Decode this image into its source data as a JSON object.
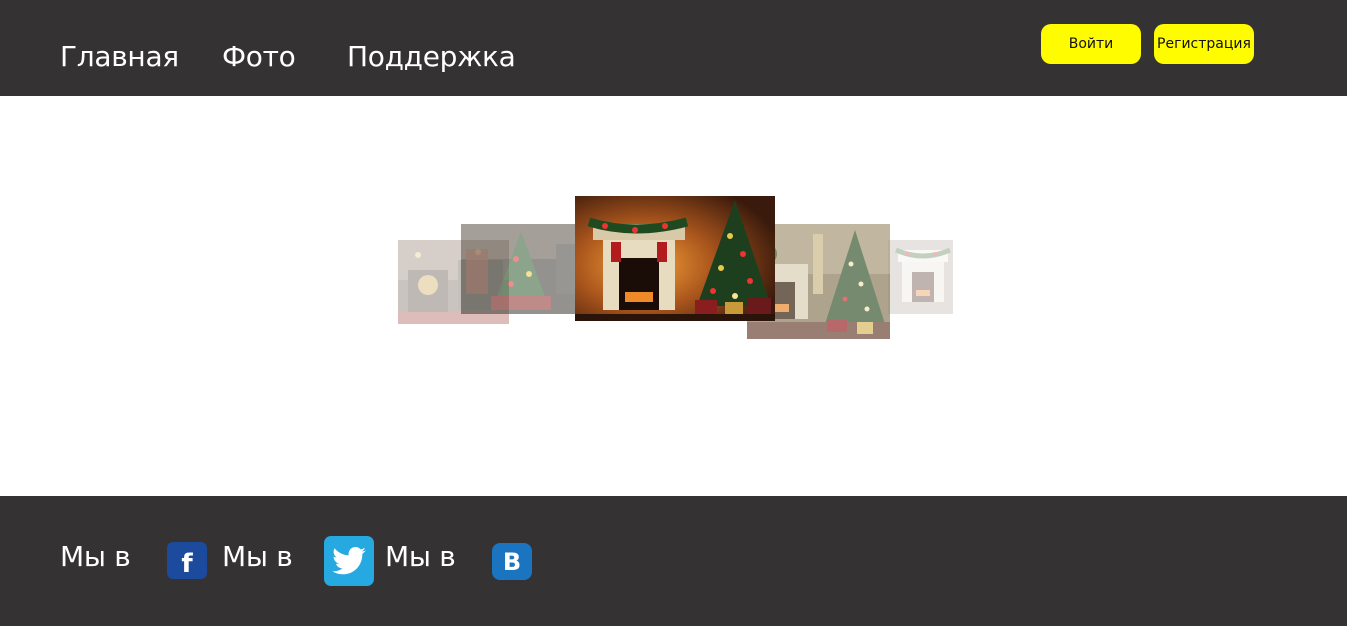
{
  "header": {
    "nav": [
      {
        "label": "Главная"
      },
      {
        "label": "Фото"
      },
      {
        "label": "Поддержка"
      }
    ],
    "login_label": "Войти",
    "register_label": "Регистрация",
    "background_color": "#343233",
    "button_color": "#fffc00"
  },
  "carousel": {
    "slides": [
      {
        "icon": "christmas-living-room-photo"
      },
      {
        "icon": "christmas-tree-room-photo"
      },
      {
        "icon": "fireplace-christmas-tree-photo"
      },
      {
        "icon": "decorated-tree-fireplace-photo"
      },
      {
        "icon": "white-fireplace-photo"
      }
    ]
  },
  "footer": {
    "texts": [
      "Мы в",
      "Мы в",
      "Мы в"
    ],
    "social": [
      {
        "icon": "facebook-icon",
        "glyph": "f",
        "color": "#1c4a9c"
      },
      {
        "icon": "twitter-icon",
        "color": "#26a8e0"
      },
      {
        "icon": "vk-icon",
        "glyph": "B",
        "color": "#1a74c0"
      }
    ],
    "background_color": "#343233"
  }
}
